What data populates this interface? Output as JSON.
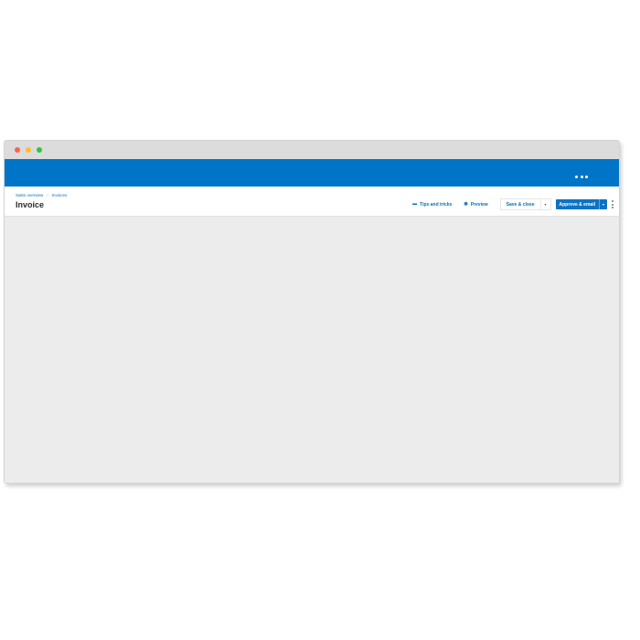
{
  "window": {
    "controls": [
      "close-icon",
      "minimize-icon",
      "maximize-icon"
    ]
  },
  "appbar": {
    "more_icon": "more-horizontal-icon",
    "color": "#0075c8"
  },
  "breadcrumb": {
    "items": [
      "Sales overview",
      "Invoices"
    ]
  },
  "page": {
    "title": "Invoice"
  },
  "actions": {
    "tips": {
      "label": "Tips and tricks",
      "icon": "lightbulb-icon"
    },
    "preview": {
      "label": "Preview",
      "icon": "eye-icon"
    },
    "save_close": {
      "label": "Save & close",
      "dropdown_icon": "chevron-down-icon"
    },
    "approve_email": {
      "label": "Approve & email",
      "dropdown_icon": "chevron-down-icon",
      "color": "#0b72c4"
    },
    "more_icon": "more-vertical-icon"
  }
}
